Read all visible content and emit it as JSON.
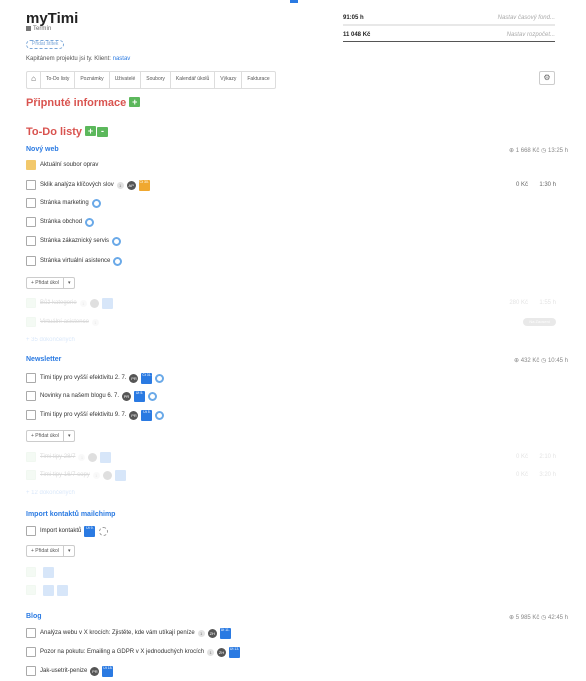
{
  "project": {
    "title": "myTimi",
    "subtitle": "Termín",
    "add_tag": "Přidat štítek",
    "captain_text": "Kapitánem projektu jsi ty. Klient: ",
    "client": "nastav"
  },
  "budget": {
    "time_value": "91:05 h",
    "time_placeholder": "Nastav časový fond...",
    "money_value": "11 048 Kč",
    "money_placeholder": "Nastav rozpočet..."
  },
  "tabs": [
    "To-Do listy",
    "Poznámky",
    "Uživatelé",
    "Soubory",
    "Kalendář úkolů",
    "Výkazy",
    "Fakturace"
  ],
  "icons": {
    "home": "home-icon",
    "gear": "gear-icon"
  },
  "pinned": {
    "heading": "Připnuté informace",
    "add": "+"
  },
  "todo": {
    "heading": "To-Do listy",
    "add": "+",
    "collapse": "-"
  },
  "lists": [
    {
      "title": "Nový web",
      "meta": "⊕ 1 668 Kč  ◷ 13:25 h",
      "note": "Aktuální soubor oprav",
      "tasks": [
        {
          "label": "Sklik analýza klíčových slov",
          "count": "1",
          "avatar": "AP",
          "date": "Čt 30.",
          "num": "0 Kč",
          "time": "1:30 h"
        },
        {
          "label": "Stránka marketing"
        },
        {
          "label": "Stránka obchod"
        },
        {
          "label": "Stránka zákaznický servis"
        },
        {
          "label": "Stránka virtuální asistence"
        }
      ],
      "add_task": "+ Přidat úkol",
      "done": [
        {
          "label": "Bůž kategorie",
          "count": "1",
          "num": "280 Kč",
          "time": "1:55 h"
        },
        {
          "label": "Virtuální asistence",
          "count": "1",
          "badge": "Na Zaosení"
        }
      ],
      "hidden_more": "+ 35 dokončených"
    },
    {
      "title": "Newsletter",
      "meta": "⊕ 432 Kč  ◷ 10:45 h",
      "tasks": [
        {
          "label": "Timi tipy pro vyšší efektivitu 2. 7.",
          "avatar": "PR",
          "date": "Čt 31."
        },
        {
          "label": "Novinky na našem blogu 6. 7.",
          "avatar": "PR",
          "date": "Út 5."
        },
        {
          "label": "Timi tipy pro vyšší efektivitu 9. 7.",
          "avatar": "PR",
          "date": "Út 5."
        }
      ],
      "add_task": "+ Přidat úkol",
      "done": [
        {
          "label": "Timi tipy 28/7",
          "count": "1",
          "num": "0 Kč",
          "time": "2:10 h"
        },
        {
          "label": "Timi tipy 16/7 copy",
          "count": "1",
          "num": "0 Kč",
          "time": "3:20 h"
        }
      ],
      "hidden_more": "+ 12 dokončených"
    },
    {
      "title": "Import kontaktů mailchimp",
      "tasks": [
        {
          "label": "Import kontaktů",
          "date": "Út 9."
        }
      ],
      "add_task": "+ Přidat úkol"
    },
    {
      "title": "Blog",
      "meta": "⊕ 5 985 Kč  ◷ 42:45 h",
      "tasks": [
        {
          "label": "Analýza webu v X krocích: Zjistěte, kde vám utíkají peníze",
          "count": "1",
          "avatar": "ZH",
          "date": "Út 11."
        },
        {
          "label": "Pozor na pokutu: Emailing a GDPR v X jednoduchých krocích",
          "count": "1",
          "avatar": "ZH",
          "date": "Út 13."
        },
        {
          "label": "Jak-usetrit-penize",
          "avatar": "PR",
          "date": "Út 18."
        }
      ]
    }
  ]
}
